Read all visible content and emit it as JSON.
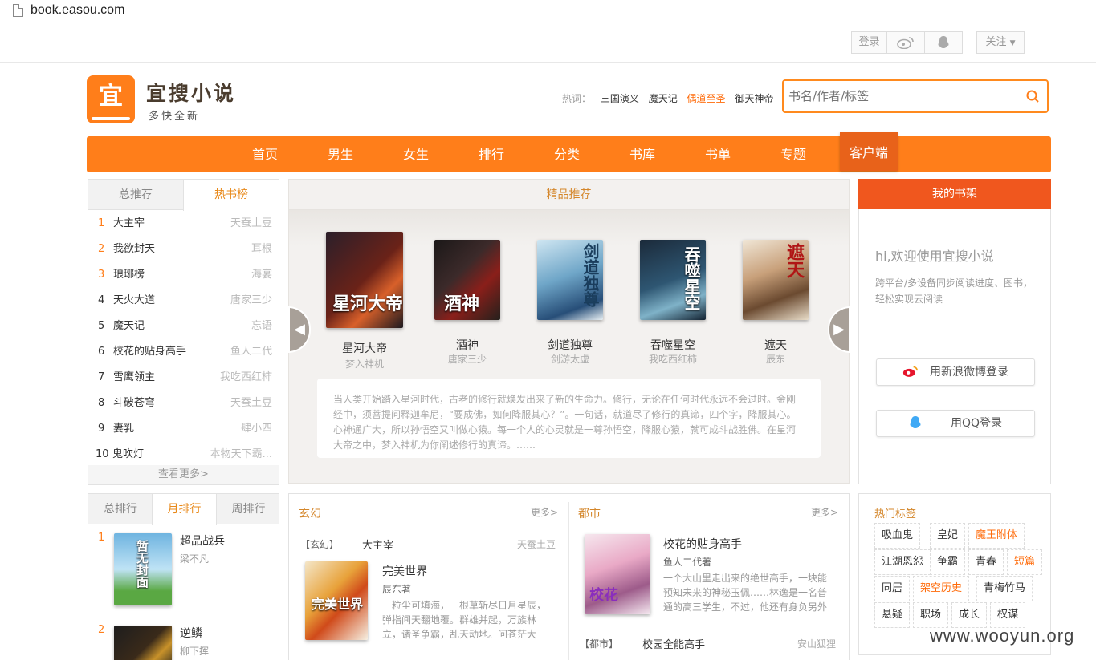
{
  "browser": {
    "url": "book.easou.com"
  },
  "topbar": {
    "login": "登录",
    "follow": "关注"
  },
  "brand": {
    "logo_char": "宜",
    "name": "宜搜小说",
    "slogan": "多快全新"
  },
  "hot": {
    "label": "热词：",
    "words": [
      "三国演义",
      "魔天记",
      "偶道至圣",
      "御天神帝"
    ]
  },
  "search": {
    "placeholder": "书名/作者/标签"
  },
  "nav": [
    "首页",
    "男生",
    "女生",
    "排行",
    "分类",
    "书库",
    "书单",
    "专题",
    "客户端"
  ],
  "hotlist": {
    "tabs": [
      "总推荐",
      "热书榜"
    ],
    "items": [
      [
        "1",
        "大主宰",
        "天蚕土豆"
      ],
      [
        "2",
        "我欲封天",
        "耳根"
      ],
      [
        "3",
        "琅琊榜",
        "海宴"
      ],
      [
        "4",
        "天火大道",
        "唐家三少"
      ],
      [
        "5",
        "魔天记",
        "忘语"
      ],
      [
        "6",
        "校花的贴身高手",
        "鱼人二代"
      ],
      [
        "7",
        "雪鹰领主",
        "我吃西红柿"
      ],
      [
        "8",
        "斗破苍穹",
        "天蚕土豆"
      ],
      [
        "9",
        "妻乳",
        "肆小四"
      ],
      [
        "10",
        "鬼吹灯",
        "本物天下霸..."
      ]
    ],
    "more": "查看更多>"
  },
  "featured": {
    "title": "精品推荐",
    "books": [
      {
        "title": "星河大帝",
        "author": "梦入神机",
        "cover": "星河大帝"
      },
      {
        "title": "酒神",
        "author": "唐家三少",
        "cover": "酒神"
      },
      {
        "title": "剑道独尊",
        "author": "剑游太虚",
        "cover": "剑道独尊"
      },
      {
        "title": "吞噬星空",
        "author": "我吃西红柿",
        "cover": "吞噬星空"
      },
      {
        "title": "遮天",
        "author": "辰东",
        "cover": "遮天"
      }
    ],
    "desc": "当人类开始踏入星河时代，古老的修行就焕发出来了新的生命力。修行，无论在任何时代永远不会过时。金刚经中，须菩提问释迦牟尼，“要成佛，如何降服其心？”。一句话，就道尽了修行的真谛，四个字，降服其心。心神通广大，所以孙悟空又叫做心猿。每一个人的心灵就是一尊孙悟空，降服心猿，就可成斗战胜佛。在星河大帝之中，梦入神机为你阐述修行的真谛。……"
  },
  "shelf": {
    "title": "我的书架",
    "welcome": "hi,欢迎使用宜搜小说",
    "sub1": "跨平台/多设备同步阅读进度、图书，",
    "sub2": "轻松实现云阅读",
    "weibo": "用新浪微博登录",
    "qq": "用QQ登录"
  },
  "ranking": {
    "tabs": [
      "总排行",
      "月排行",
      "周排行"
    ],
    "items": [
      {
        "n": "1",
        "title": "超品战兵",
        "author": "梁不凡",
        "cover": "暂无封面"
      },
      {
        "n": "2",
        "title": "逆鳞",
        "author": "柳下挥",
        "cover": ""
      }
    ]
  },
  "xuanhuan": {
    "title": "玄幻",
    "more": "更多>",
    "top": {
      "cat": "【玄幻】",
      "title": "大主宰",
      "author": "天蚕土豆"
    },
    "book": {
      "title": "完美世界",
      "author": "辰东著",
      "desc1": "一粒尘可填海，一根草斩尽日月星辰，",
      "desc2": "弹指间天翻地覆。群雄并起，万族林",
      "desc3": "立，诸圣争霸，乱天动地。问苍茫大",
      "cover": "完美世界"
    }
  },
  "dushi": {
    "title": "都市",
    "more": "更多>",
    "book": {
      "title": "校花的贴身高手",
      "author": "鱼人二代著",
      "desc1": "一个大山里走出来的绝世高手，一块能",
      "desc2": "预知未来的神秘玉佩……林逸是一名普",
      "desc3": "通的高三学生，不过，他还有身负另外",
      "cover": "校花"
    },
    "bottom": {
      "cat": "【都市】",
      "title": "校园全能高手",
      "author": "安山狐狸"
    }
  },
  "tags": {
    "title": "热门标签",
    "rows": [
      [
        {
          "t": "吸血鬼"
        },
        {
          "t": "皇妃"
        },
        {
          "t": "魔王附体",
          "hi": true
        }
      ],
      [
        {
          "t": "江湖恩怨"
        },
        {
          "t": "争霸"
        },
        {
          "t": "青春"
        },
        {
          "t": "短篇",
          "hi": true
        }
      ],
      [
        {
          "t": "同居"
        },
        {
          "t": "架空历史",
          "hi": true
        },
        {
          "t": "青梅竹马"
        }
      ],
      [
        {
          "t": "悬疑"
        },
        {
          "t": "职场"
        },
        {
          "t": "成长"
        },
        {
          "t": "权谋"
        }
      ]
    ]
  },
  "watermark": "www.wooyun.org"
}
